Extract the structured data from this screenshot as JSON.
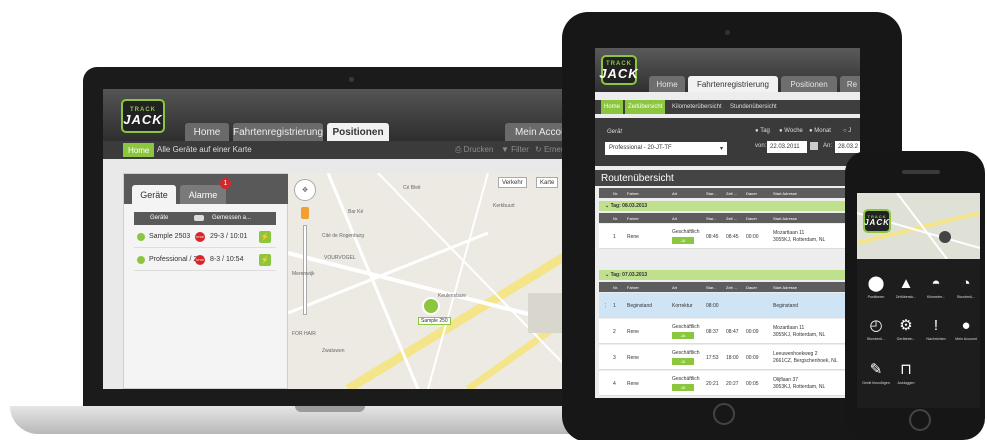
{
  "laptop": {
    "logo": {
      "line1": "TRACK",
      "line2": "JACK"
    },
    "tabs": [
      "Home",
      "Fahrtenregistrierung",
      "Positionen",
      "Mein Account"
    ],
    "subnav": {
      "home": "Home",
      "crumb": "Alle Geräte auf einer Karte",
      "print": "Drucken",
      "filter": "Filter",
      "refresh": "Erneu"
    },
    "panel": {
      "tabs": [
        "Geräte",
        "Alarme"
      ],
      "alarm_badge": "1",
      "headers": [
        "Geräte",
        "Gemessen a..."
      ],
      "rows": [
        {
          "name": "Sample 2503",
          "time": "29-3 / 10:01"
        },
        {
          "name": "Professional / 2...",
          "time": "8-3 / 10:54"
        }
      ]
    },
    "map": {
      "buttons": [
        "Verkehr",
        "Karte"
      ],
      "pin_label": "Sample 250",
      "labels": [
        "Cé Bleit",
        "Bar Ké",
        "Kerkbuurt",
        "Cité de Rogenburg",
        "VOURVOGEL",
        "Zwaluwen",
        "FOR HAIR",
        "Keulensbare",
        "Merenwijk"
      ]
    }
  },
  "tablet": {
    "logo": {
      "line1": "TRACK",
      "line2": "JACK"
    },
    "tabs": [
      "Home",
      "Fahrtenregistrierung",
      "Positionen",
      "Re"
    ],
    "subnav": [
      "Home",
      "Zeitübersicht",
      "Kilometerübersicht",
      "Stundenübersicht"
    ],
    "filter": {
      "label": "Gerät",
      "selected": "Professional - 20-JT-TF",
      "periods": [
        "Tag",
        "Woche",
        "Monat",
        "J"
      ],
      "from_label": "von:",
      "from": "22.03.2011",
      "to_label": "An:",
      "to": "28.03.2"
    },
    "title": "Routenübersicht",
    "headers": [
      "Nr.",
      "Fahrer",
      "Art",
      "Star...",
      "Zeit ...",
      "Dauer",
      "Start Adresse"
    ],
    "days": [
      {
        "label": "Tag: 08.03.2013",
        "rows": [
          {
            "nr": "1",
            "driver": "Rene",
            "art": "Geschäftlich",
            "ja": "JA",
            "start": "08:45",
            "end": "08:45",
            "dur": "00:00",
            "addr1": "Mozartlaan 11",
            "addr2": "3055KJ, Rotterdam, NL"
          }
        ]
      },
      {
        "label": "Tag: 07.03.2013",
        "rows": [
          {
            "nr": "1",
            "driver": "Beginstand",
            "art": "Korrektur",
            "ja": "",
            "start": "08:00",
            "end": "",
            "dur": "",
            "addr1": "Beginstand",
            "addr2": ""
          },
          {
            "nr": "2",
            "driver": "Rene",
            "art": "Geschäftlich",
            "ja": "JA",
            "start": "08:37",
            "end": "08:47",
            "dur": "00:09",
            "addr1": "Mozartlaan 11",
            "addr2": "3055KJ, Rotterdam, NL"
          },
          {
            "nr": "3",
            "driver": "Rene",
            "art": "Geschäftlich",
            "ja": "JA",
            "start": "17:53",
            "end": "18:00",
            "dur": "00:09",
            "addr1": "Leeuwenhoekweg 2",
            "addr2": "2661CZ, Bergschenhoek, NL"
          },
          {
            "nr": "4",
            "driver": "Rene",
            "art": "Geschäftlich",
            "ja": "JA",
            "start": "20:21",
            "end": "20:27",
            "dur": "00:05",
            "addr1": "Olijflaan 37",
            "addr2": "3053KJ, Rotterdam, NL"
          }
        ]
      }
    ]
  },
  "phone": {
    "logo": {
      "line1": "TRACK",
      "line2": "JACK"
    },
    "menu": [
      {
        "label": "Positionen",
        "icon": "location-pin-icon",
        "glyph": "⬤"
      },
      {
        "label": "Zeitübersic...",
        "icon": "navigation-arrow-icon",
        "glyph": "▲"
      },
      {
        "label": "Kilometer...",
        "icon": "speedometer-icon",
        "glyph": "◓"
      },
      {
        "label": "Stundenü...",
        "icon": "stopwatch-icon",
        "glyph": "◔"
      },
      {
        "label": "Stundenü...",
        "icon": "stopwatch-icon",
        "glyph": "◴"
      },
      {
        "label": "Geräteein...",
        "icon": "gears-icon",
        "glyph": "⚙"
      },
      {
        "label": "Nachrichten",
        "icon": "speech-bubble-icon",
        "glyph": "!"
      },
      {
        "label": "Mein Account",
        "icon": "user-icon",
        "glyph": "●"
      },
      {
        "label": "Gerät hinzufügen",
        "icon": "edit-icon",
        "glyph": "✎"
      },
      {
        "label": "Ausloggen",
        "icon": "unlock-icon",
        "glyph": "⊓"
      }
    ]
  },
  "colors": {
    "brand_green": "#8cc63f",
    "alert_red": "#d7262a",
    "header_dark": "#3b3b3b"
  }
}
